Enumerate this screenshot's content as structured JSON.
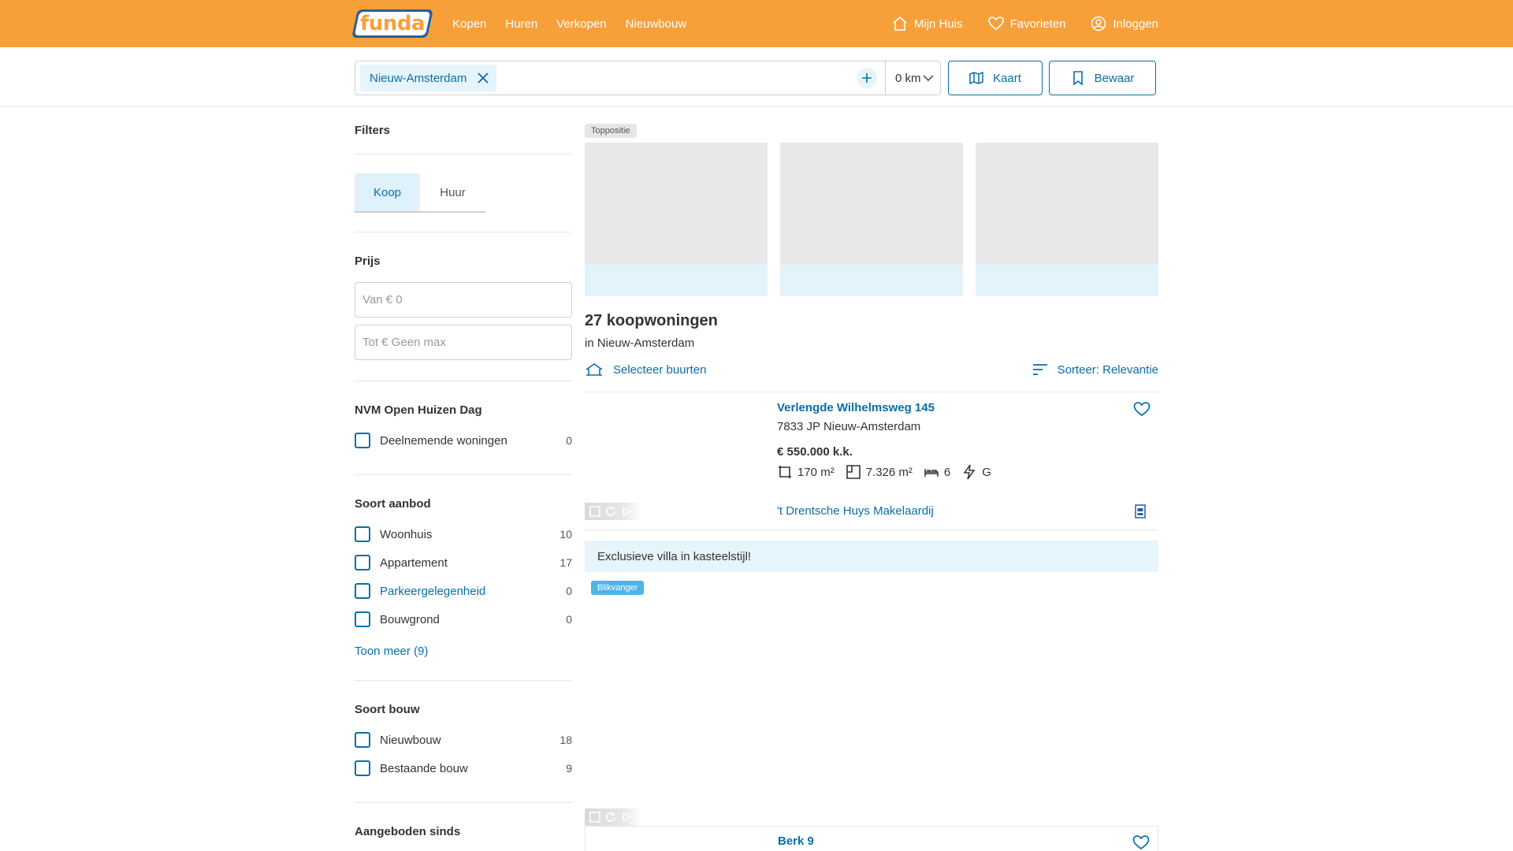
{
  "header": {
    "logo_text": "funda",
    "nav": [
      "Kopen",
      "Huren",
      "Verkopen",
      "Nieuwbouw"
    ],
    "my_home": "Mijn Huis",
    "favorites": "Favorieten",
    "login": "Inloggen"
  },
  "search": {
    "location_chip": "Nieuw-Amsterdam",
    "radius": "0 km",
    "map_button": "Kaart",
    "save_button": "Bewaar"
  },
  "filters": {
    "title": "Filters",
    "tabs": [
      "Koop",
      "Huur"
    ],
    "active_tab": "Koop",
    "price": {
      "title": "Prijs",
      "from_placeholder": "Van € 0",
      "to_placeholder": "Tot € Geen max"
    },
    "open_house": {
      "title": "NVM Open Huizen Dag",
      "items": [
        {
          "label": "Deelnemende woningen",
          "count": "0"
        }
      ]
    },
    "offer_type": {
      "title": "Soort aanbod",
      "items": [
        {
          "label": "Woonhuis",
          "count": "10"
        },
        {
          "label": "Appartement",
          "count": "17"
        },
        {
          "label": "Parkeergelegenheid",
          "count": "0"
        },
        {
          "label": "Bouwgrond",
          "count": "0"
        }
      ],
      "show_more": "Toon meer (9)"
    },
    "build_type": {
      "title": "Soort bouw",
      "items": [
        {
          "label": "Nieuwbouw",
          "count": "18"
        },
        {
          "label": "Bestaande bouw",
          "count": "9"
        }
      ]
    },
    "offered_since": {
      "title": "Aangeboden sinds"
    }
  },
  "results": {
    "top_badge": "Toppositie",
    "count_title": "27 koopwoningen",
    "location_line": "in Nieuw-Amsterdam",
    "select_neighborhoods": "Selecteer buurten",
    "sort": "Sorteer: Relevantie",
    "listings": [
      {
        "street": "Verlengde Wilhelmsweg 145",
        "city": "7833 JP Nieuw-Amsterdam",
        "price": "€ 550.000 k.k.",
        "living_area": "170 m²",
        "plot_area": "7.326 m²",
        "rooms": "6",
        "energy": "G",
        "agent": "'t Drentsche Huys Makelaardij",
        "tagline": "Exclusieve villa in kasteelstijl!",
        "badge": "Blikvanger"
      },
      {
        "street": "Berk 9"
      }
    ]
  },
  "colors": {
    "brand_orange": "#f7a03a",
    "link_blue": "#0a6ea8",
    "light_blue": "#e6f4fb"
  }
}
